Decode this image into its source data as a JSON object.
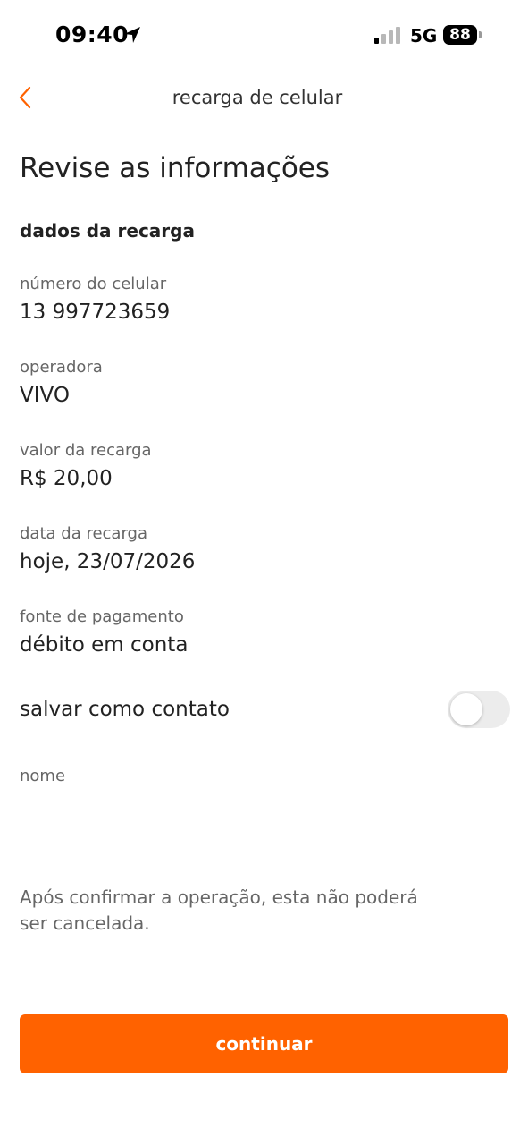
{
  "status_bar": {
    "time": "09:40",
    "network": "5G",
    "battery": "88"
  },
  "header": {
    "title": "recarga de celular",
    "back_icon": "chevron-left-icon"
  },
  "page_title": "Revise as informações",
  "section_title": "dados da recarga",
  "fields": [
    {
      "label": "número do celular",
      "value": "13 997723659"
    },
    {
      "label": "operadora",
      "value": "VIVO"
    },
    {
      "label": "valor da recarga",
      "value": "R$ 20,00"
    },
    {
      "label": "data da recarga",
      "value": "hoje, 23/07/2026"
    },
    {
      "label": "fonte de pagamento",
      "value": "débito em conta"
    }
  ],
  "save_contact": {
    "label": "salvar como contato",
    "enabled": false
  },
  "name_field": {
    "label": "nome",
    "value": ""
  },
  "notice": "Após confirmar a operação, esta não poderá ser cancelada.",
  "continue_button": "continuar",
  "colors": {
    "accent": "#ff6200",
    "label": "#666666",
    "text": "#222222"
  }
}
